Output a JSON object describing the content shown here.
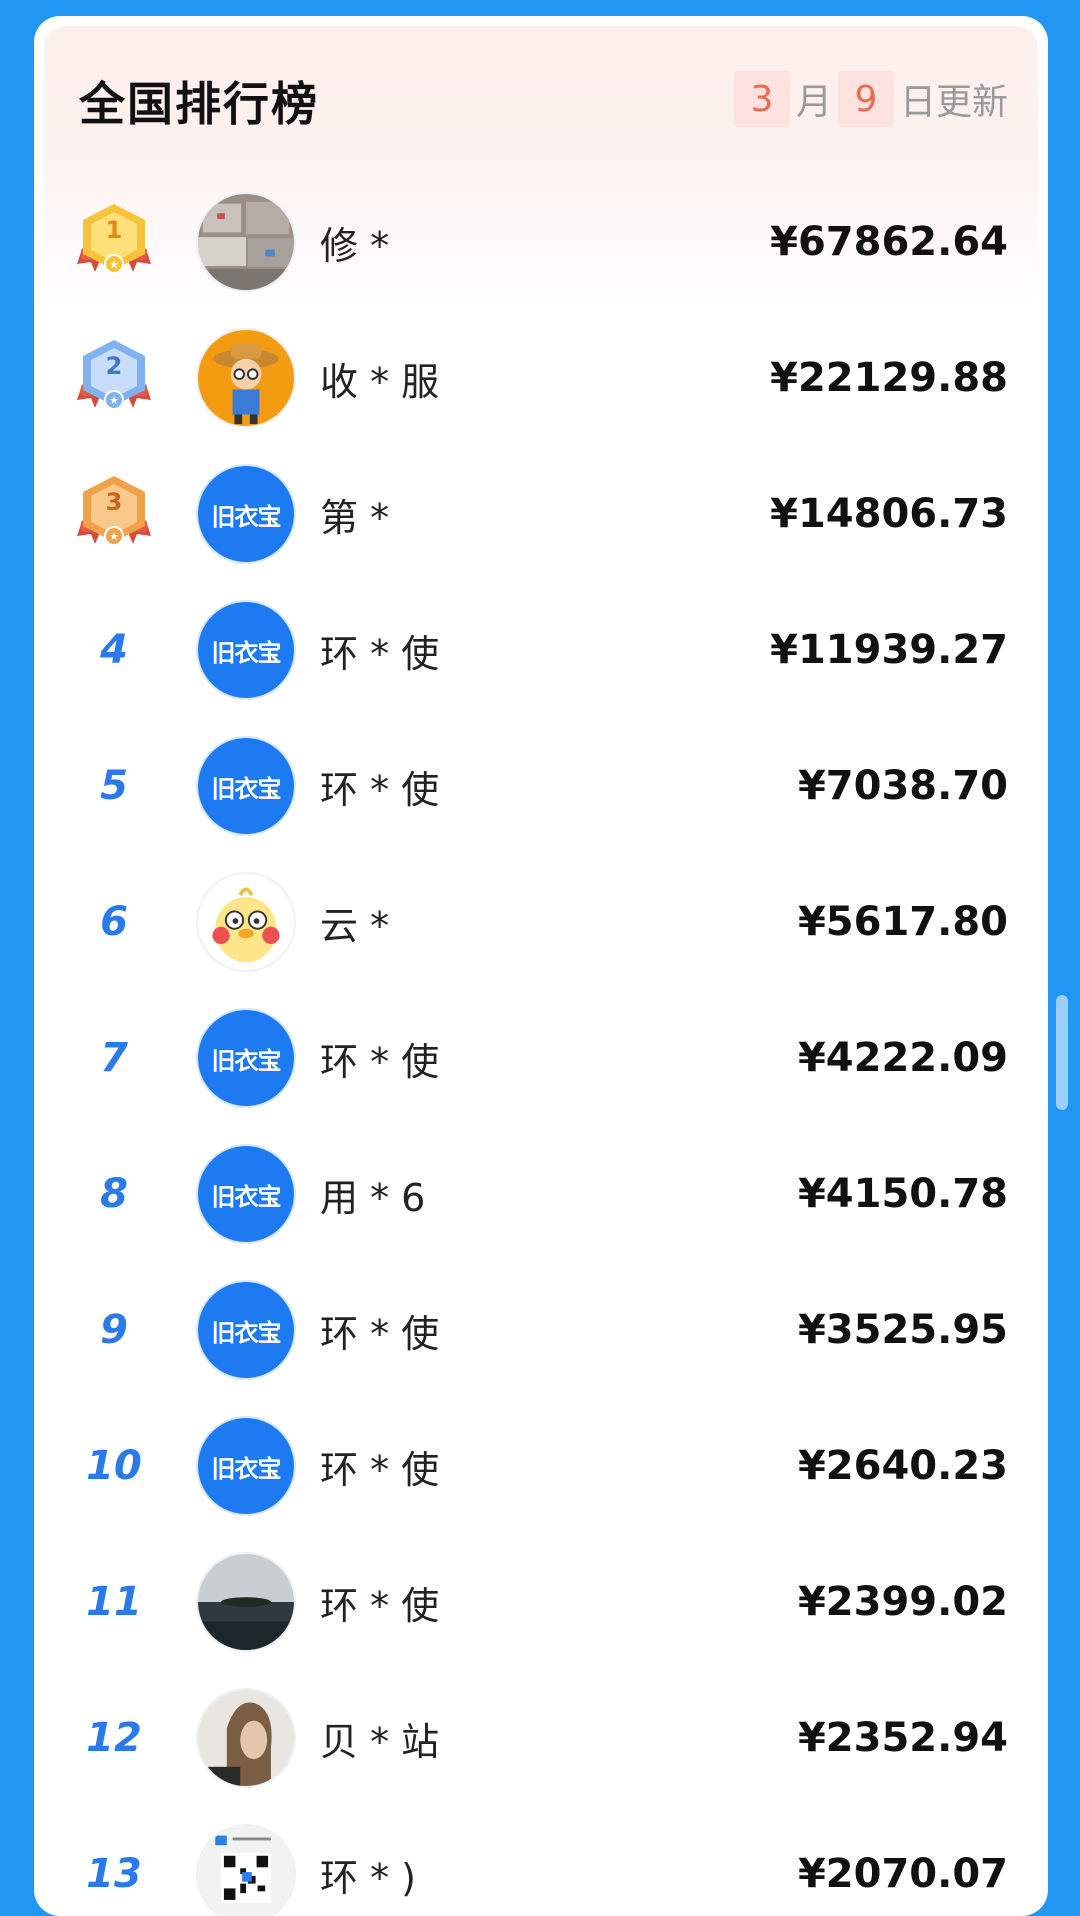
{
  "header": {
    "title": "全国排行榜",
    "month": "3",
    "month_label": "月",
    "day": "9",
    "day_label": "日更新"
  },
  "colors": {
    "background": "#2196F3",
    "rank_number": "#2a7be9",
    "brand_avatar": "#1d7af0",
    "date_highlight": "#ee6a4f"
  },
  "rows": [
    {
      "rank": "1",
      "name": "修 *",
      "amount": "¥67862.64",
      "avatar": "clothes-bundle-photo",
      "medal": "gold"
    },
    {
      "rank": "2",
      "name": "收 * 服",
      "amount": "¥22129.88",
      "avatar": "farmer-cartoon",
      "medal": "silver"
    },
    {
      "rank": "3",
      "name": "第 *",
      "amount": "¥14806.73",
      "avatar": "brand-logo",
      "medal": "bronze"
    },
    {
      "rank": "4",
      "name": "环 * 使",
      "amount": "¥11939.27",
      "avatar": "brand-logo"
    },
    {
      "rank": "5",
      "name": "环 * 使",
      "amount": "¥7038.70",
      "avatar": "brand-logo"
    },
    {
      "rank": "6",
      "name": "云 *",
      "amount": "¥5617.80",
      "avatar": "chick-cartoon"
    },
    {
      "rank": "7",
      "name": "环 * 使",
      "amount": "¥4222.09",
      "avatar": "brand-logo"
    },
    {
      "rank": "8",
      "name": "用 * 6",
      "amount": "¥4150.78",
      "avatar": "brand-logo"
    },
    {
      "rank": "9",
      "name": "环 * 使",
      "amount": "¥3525.95",
      "avatar": "brand-logo"
    },
    {
      "rank": "10",
      "name": "环 * 使",
      "amount": "¥2640.23",
      "avatar": "brand-logo"
    },
    {
      "rank": "11",
      "name": "环 * 使",
      "amount": "¥2399.02",
      "avatar": "lake-photo"
    },
    {
      "rank": "12",
      "name": "贝 * 站",
      "amount": "¥2352.94",
      "avatar": "portrait-photo"
    },
    {
      "rank": "13",
      "name": "环 * )",
      "amount": "¥2070.07",
      "avatar": "qr-code"
    }
  ],
  "brand_logo_text": "旧衣宝"
}
